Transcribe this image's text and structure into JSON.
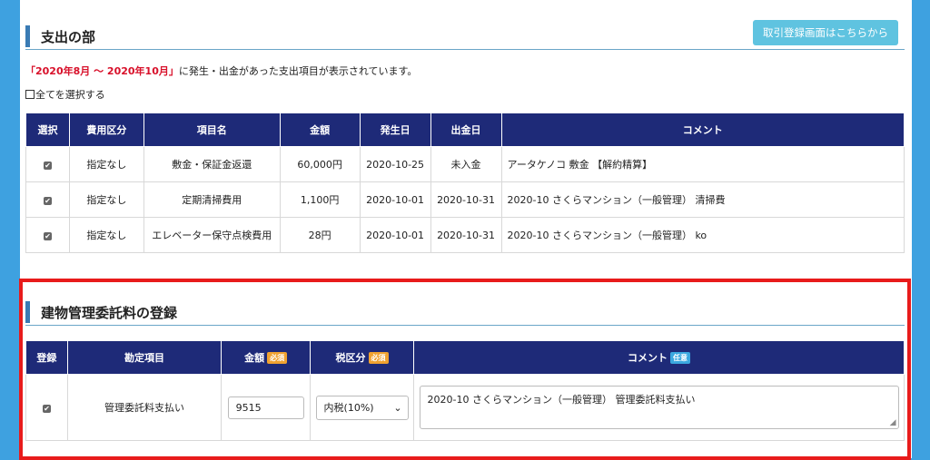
{
  "expense": {
    "title": "支出の部",
    "register_button": "取引登録画面はこちらから",
    "period": "「2020年8月 ～ 2020年10月」",
    "note": "に発生・出金があった支出項目が表示されています。",
    "select_all": "全てを選択する",
    "headers": [
      "選択",
      "費用区分",
      "項目名",
      "金額",
      "発生日",
      "出金日",
      "コメント"
    ],
    "rows": [
      {
        "checked": "✔",
        "category": "指定なし",
        "item": "敷金・保証金返還",
        "amount": "60,000円",
        "occurred": "2020-10-25",
        "paid": "未入金",
        "comment": "アータケノコ 敷金 【解約精算】"
      },
      {
        "checked": "✔",
        "category": "指定なし",
        "item": "定期清掃費用",
        "amount": "1,100円",
        "occurred": "2020-10-01",
        "paid": "2020-10-31",
        "comment": "2020-10 さくらマンション（一般管理） 清掃費"
      },
      {
        "checked": "✔",
        "category": "指定なし",
        "item": "エレベーター保守点検費用",
        "amount": "28円",
        "occurred": "2020-10-01",
        "paid": "2020-10-31",
        "comment": "2020-10 さくらマンション（一般管理） ko"
      }
    ]
  },
  "mgmt": {
    "title": "建物管理委託料の登録",
    "headers": {
      "register": "登録",
      "account": "勘定項目",
      "amount": "金額",
      "tax": "税区分",
      "comment": "コメント",
      "required": "必須",
      "optional": "任意"
    },
    "row": {
      "checked": "✔",
      "account": "管理委託料支払い",
      "amount_value": "9515",
      "tax_value": "内税(10%)",
      "comment_value": "2020-10 さくらマンション（一般管理） 管理委託料支払い"
    }
  },
  "icons": {
    "caret": "chevron-down-icon",
    "resize": "resize-grip-icon"
  },
  "colors": {
    "header_bg": "#1e2a78",
    "accent_red": "#e81b1b",
    "badge_required": "#f0a230",
    "badge_optional": "#3ba8e0",
    "button": "#5fc3e0"
  }
}
